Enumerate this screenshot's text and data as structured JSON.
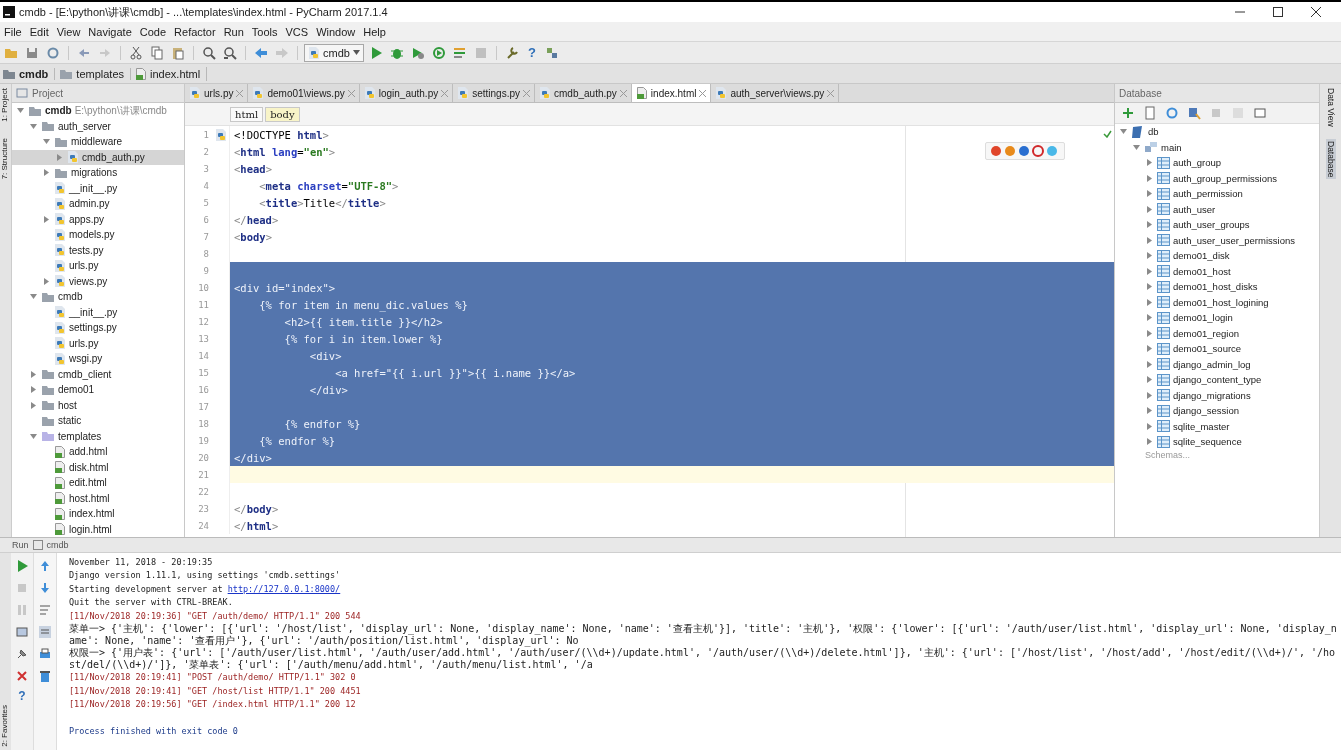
{
  "window": {
    "title": "cmdb - [E:\\python\\讲课\\cmdb] - ...\\templates\\index.html - PyCharm 2017.1.4"
  },
  "menu": [
    "File",
    "Edit",
    "View",
    "Navigate",
    "Code",
    "Refactor",
    "Run",
    "Tools",
    "VCS",
    "Window",
    "Help"
  ],
  "toolbar": {
    "run_config": "cmdb",
    "help": "?"
  },
  "nav_bar": [
    {
      "label": "cmdb",
      "kind": "project"
    },
    {
      "label": "templates",
      "kind": "folder"
    },
    {
      "label": "index.html",
      "kind": "html"
    }
  ],
  "side_tabs_left": [
    "1: Project",
    "7: Structure",
    "2: Favorites"
  ],
  "side_tabs_right": [
    {
      "label": "Data View",
      "selected": false
    },
    {
      "label": "Database",
      "selected": true
    }
  ],
  "project": {
    "title": "Project",
    "tree": [
      {
        "label": "cmdb",
        "path": "E:\\python\\讲课\\cmdb",
        "kind": "folder",
        "expanded": true,
        "selected": false,
        "children": [
          {
            "label": "auth_server",
            "kind": "folder",
            "expanded": true,
            "selected": false,
            "children": [
              {
                "label": "middleware",
                "kind": "folder",
                "expanded": true,
                "selected": false,
                "children": [
                  {
                    "label": "cmdb_auth.py",
                    "kind": "py",
                    "expanded": false,
                    "selected": true
                  }
                ]
              },
              {
                "label": "migrations",
                "kind": "folder",
                "expanded": false,
                "selected": false
              },
              {
                "label": "__init__.py",
                "kind": "py",
                "selected": false
              },
              {
                "label": "admin.py",
                "kind": "py",
                "selected": false
              },
              {
                "label": "apps.py",
                "kind": "py",
                "expanded": false,
                "selected": false
              },
              {
                "label": "models.py",
                "kind": "py",
                "selected": false
              },
              {
                "label": "tests.py",
                "kind": "py",
                "selected": false
              },
              {
                "label": "urls.py",
                "kind": "py",
                "selected": false
              },
              {
                "label": "views.py",
                "kind": "py",
                "expanded": false,
                "selected": false
              }
            ]
          },
          {
            "label": "cmdb",
            "kind": "folder",
            "expanded": true,
            "selected": false,
            "children": [
              {
                "label": "__init__.py",
                "kind": "py",
                "selected": false
              },
              {
                "label": "settings.py",
                "kind": "py",
                "selected": false
              },
              {
                "label": "urls.py",
                "kind": "py",
                "selected": false
              },
              {
                "label": "wsgi.py",
                "kind": "py",
                "selected": false
              }
            ]
          },
          {
            "label": "cmdb_client",
            "kind": "folder",
            "expanded": false,
            "selected": false
          },
          {
            "label": "demo01",
            "kind": "folder",
            "expanded": false,
            "selected": false
          },
          {
            "label": "host",
            "kind": "folder",
            "expanded": false,
            "selected": false
          },
          {
            "label": "static",
            "kind": "folder",
            "selected": false
          },
          {
            "label": "templates",
            "kind": "tfolder",
            "expanded": true,
            "selected": false,
            "children": [
              {
                "label": "add.html",
                "kind": "html",
                "selected": false
              },
              {
                "label": "disk.html",
                "kind": "html",
                "selected": false
              },
              {
                "label": "edit.html",
                "kind": "html",
                "selected": false
              },
              {
                "label": "host.html",
                "kind": "html",
                "selected": false
              },
              {
                "label": "index.html",
                "kind": "html",
                "selected": false
              },
              {
                "label": "login.html",
                "kind": "html",
                "selected": false
              }
            ]
          }
        ]
      }
    ]
  },
  "editor_tabs": [
    {
      "label": "urls.py",
      "kind": "py",
      "selected": false
    },
    {
      "label": "demo01\\views.py",
      "kind": "py",
      "selected": false
    },
    {
      "label": "login_auth.py",
      "kind": "py",
      "selected": false
    },
    {
      "label": "settings.py",
      "kind": "py",
      "selected": false
    },
    {
      "label": "cmdb_auth.py",
      "kind": "py",
      "selected": false
    },
    {
      "label": "index.html",
      "kind": "html",
      "selected": true
    },
    {
      "label": "auth_server\\views.py",
      "kind": "py",
      "selected": false
    }
  ],
  "breadcrumbs": [
    {
      "label": "html",
      "selected": false
    },
    {
      "label": "body",
      "selected": true
    }
  ],
  "code": [
    {
      "n": "1",
      "selected": false,
      "current": false,
      "segs": [
        {
          "kind": "text",
          "t": "<!DOCTYPE "
        },
        {
          "kind": "tag",
          "t": "html"
        },
        {
          "kind": "p",
          "t": ">"
        }
      ]
    },
    {
      "n": "2",
      "selected": false,
      "current": false,
      "segs": [
        {
          "kind": "p",
          "t": "<"
        },
        {
          "kind": "tag",
          "t": "html"
        },
        {
          "kind": "attr",
          "t": " lang"
        },
        {
          "kind": "text",
          "t": "="
        },
        {
          "kind": "str",
          "t": "\"en\""
        },
        {
          "kind": "p",
          "t": ">"
        }
      ]
    },
    {
      "n": "3",
      "selected": false,
      "current": false,
      "segs": [
        {
          "kind": "p",
          "t": "<"
        },
        {
          "kind": "tag",
          "t": "head"
        },
        {
          "kind": "p",
          "t": ">"
        }
      ]
    },
    {
      "n": "4",
      "selected": false,
      "current": false,
      "segs": [
        {
          "kind": "p",
          "t": "    <"
        },
        {
          "kind": "tag",
          "t": "meta"
        },
        {
          "kind": "attr",
          "t": " charset"
        },
        {
          "kind": "text",
          "t": "="
        },
        {
          "kind": "str",
          "t": "\"UTF-8\""
        },
        {
          "kind": "p",
          "t": ">"
        }
      ]
    },
    {
      "n": "5",
      "selected": false,
      "current": false,
      "segs": [
        {
          "kind": "p",
          "t": "    <"
        },
        {
          "kind": "tag",
          "t": "title"
        },
        {
          "kind": "p",
          "t": ">"
        },
        {
          "kind": "text",
          "t": "Title"
        },
        {
          "kind": "p",
          "t": "</"
        },
        {
          "kind": "tag",
          "t": "title"
        },
        {
          "kind": "p",
          "t": ">"
        }
      ]
    },
    {
      "n": "6",
      "selected": false,
      "current": false,
      "segs": [
        {
          "kind": "p",
          "t": "</"
        },
        {
          "kind": "tag",
          "t": "head"
        },
        {
          "kind": "p",
          "t": ">"
        }
      ]
    },
    {
      "n": "7",
      "selected": false,
      "current": false,
      "segs": [
        {
          "kind": "p",
          "t": "<"
        },
        {
          "kind": "tag",
          "t": "body"
        },
        {
          "kind": "p",
          "t": ">"
        }
      ]
    },
    {
      "n": "8",
      "selected": false,
      "current": false
    },
    {
      "n": "9",
      "selected": true,
      "current": false
    },
    {
      "n": "10",
      "selected": true,
      "current": false,
      "segs": [
        {
          "kind": "text",
          "t": "<div id=\"index\">"
        }
      ]
    },
    {
      "n": "11",
      "selected": true,
      "current": false,
      "segs": [
        {
          "kind": "text",
          "t": "    {% for item in menu_dic.values %}"
        }
      ]
    },
    {
      "n": "12",
      "selected": true,
      "current": false,
      "segs": [
        {
          "kind": "text",
          "t": "        <h2>{{ item.title }}</h2>"
        }
      ]
    },
    {
      "n": "13",
      "selected": true,
      "current": false,
      "segs": [
        {
          "kind": "text",
          "t": "        {% for i in item.lower %}"
        }
      ]
    },
    {
      "n": "14",
      "selected": true,
      "current": false,
      "segs": [
        {
          "kind": "text",
          "t": "            <div>"
        }
      ]
    },
    {
      "n": "15",
      "selected": true,
      "current": false,
      "segs": [
        {
          "kind": "text",
          "t": "                <a href=\"{{ i.url }}\">{{ i.name }}</a>"
        }
      ]
    },
    {
      "n": "16",
      "selected": true,
      "current": false,
      "segs": [
        {
          "kind": "text",
          "t": "            </div>"
        }
      ]
    },
    {
      "n": "17",
      "selected": true,
      "current": false
    },
    {
      "n": "18",
      "selected": true,
      "current": false,
      "segs": [
        {
          "kind": "text",
          "t": "        {% endfor %}"
        }
      ]
    },
    {
      "n": "19",
      "selected": true,
      "current": false,
      "segs": [
        {
          "kind": "text",
          "t": "    {% endfor %}"
        }
      ]
    },
    {
      "n": "20",
      "selected": true,
      "current": false,
      "segs": [
        {
          "kind": "text",
          "t": "</div>"
        }
      ]
    },
    {
      "n": "21",
      "selected": false,
      "current": true
    },
    {
      "n": "22",
      "selected": false,
      "current": false
    },
    {
      "n": "23",
      "selected": false,
      "current": false,
      "segs": [
        {
          "kind": "p",
          "t": "</"
        },
        {
          "kind": "tag",
          "t": "body"
        },
        {
          "kind": "p",
          "t": ">"
        }
      ]
    },
    {
      "n": "24",
      "selected": false,
      "current": false,
      "segs": [
        {
          "kind": "p",
          "t": "</"
        },
        {
          "kind": "tag",
          "t": "html"
        },
        {
          "kind": "p",
          "t": ">"
        }
      ]
    }
  ],
  "database": {
    "title": "Database",
    "tree": [
      {
        "label": "db",
        "kind": "db",
        "expanded": true,
        "children": [
          {
            "label": "main",
            "kind": "schema",
            "expanded": true,
            "children": [
              {
                "label": "auth_group",
                "kind": "table",
                "expanded": false
              },
              {
                "label": "auth_group_permissions",
                "kind": "table",
                "expanded": false
              },
              {
                "label": "auth_permission",
                "kind": "table",
                "expanded": false
              },
              {
                "label": "auth_user",
                "kind": "table",
                "expanded": false
              },
              {
                "label": "auth_user_groups",
                "kind": "table",
                "expanded": false
              },
              {
                "label": "auth_user_user_permissions",
                "kind": "table",
                "expanded": false
              },
              {
                "label": "demo01_disk",
                "kind": "table",
                "expanded": false
              },
              {
                "label": "demo01_host",
                "kind": "table",
                "expanded": false
              },
              {
                "label": "demo01_host_disks",
                "kind": "table",
                "expanded": false
              },
              {
                "label": "demo01_host_logining",
                "kind": "table",
                "expanded": false
              },
              {
                "label": "demo01_login",
                "kind": "table",
                "expanded": false
              },
              {
                "label": "demo01_region",
                "kind": "table",
                "expanded": false
              },
              {
                "label": "demo01_source",
                "kind": "table",
                "expanded": false
              },
              {
                "label": "django_admin_log",
                "kind": "table",
                "expanded": false
              },
              {
                "label": "django_content_type",
                "kind": "table",
                "expanded": false
              },
              {
                "label": "django_migrations",
                "kind": "table",
                "expanded": false
              },
              {
                "label": "django_session",
                "kind": "table",
                "expanded": false
              },
              {
                "label": "sqlite_master",
                "kind": "table",
                "expanded": false
              },
              {
                "label": "sqlite_sequence",
                "kind": "table",
                "expanded": false
              }
            ]
          }
        ]
      }
    ],
    "footer": "Schemas..."
  },
  "run": {
    "title": "Run",
    "config": "cmdb",
    "help": "?",
    "console": [
      {
        "kind": "info",
        "text": "November 11, 2018 - 20:19:35"
      },
      {
        "kind": "info",
        "text": "Django version 1.11.1, using settings 'cmdb.settings'"
      },
      {
        "kind": "info",
        "text": "Starting development server at ",
        "link": "http://127.0.0.1:8000/"
      },
      {
        "kind": "info",
        "text": "Quit the server with CTRL-BREAK."
      },
      {
        "kind": "log",
        "text": "[11/Nov/2018 20:19:36] \"GET /auth/demo/ HTTP/1.1\" 200 544"
      },
      {
        "kind": "dict",
        "text": "菜单一> {'主机': {'lower': [{'url': '/host/list', 'display_url': None, 'display_name': None, 'name': '查看主机'}], 'title': '主机'}, '权限': {'lower': [{'url': '/auth/user/list.html', 'display_url': None, 'display_name': None, 'name': '查看用户'}, {'url': '/auth/position/list.html', 'display_url': No"
      },
      {
        "kind": "dict",
        "text": "权限一> {'用户表': {'url': ['/auth/user/list.html', '/auth/user/add.html', '/auth/user/(\\\\d+)/update.html', '/auth/user/(\\\\d+)/delete.html']}, '主机': {'url': ['/host/list', '/host/add', '/host/edit/(\\\\d+)/', '/host/del/(\\\\d+)/']}, '菜单表': {'url': ['/auth/menu/add.html', '/auth/menu/list.html', '/a"
      },
      {
        "kind": "log",
        "text": "[11/Nov/2018 20:19:41] \"POST /auth/demo/ HTTP/1.1\" 302 0"
      },
      {
        "kind": "log",
        "text": "[11/Nov/2018 20:19:41] \"GET /host/list HTTP/1.1\" 200 4451"
      },
      {
        "kind": "log",
        "text": "[11/Nov/2018 20:19:56] \"GET /index.html HTTP/1.1\" 200 12"
      },
      {
        "kind": "blank"
      },
      {
        "kind": "exit",
        "text": "Process finished with exit code 0"
      }
    ]
  }
}
